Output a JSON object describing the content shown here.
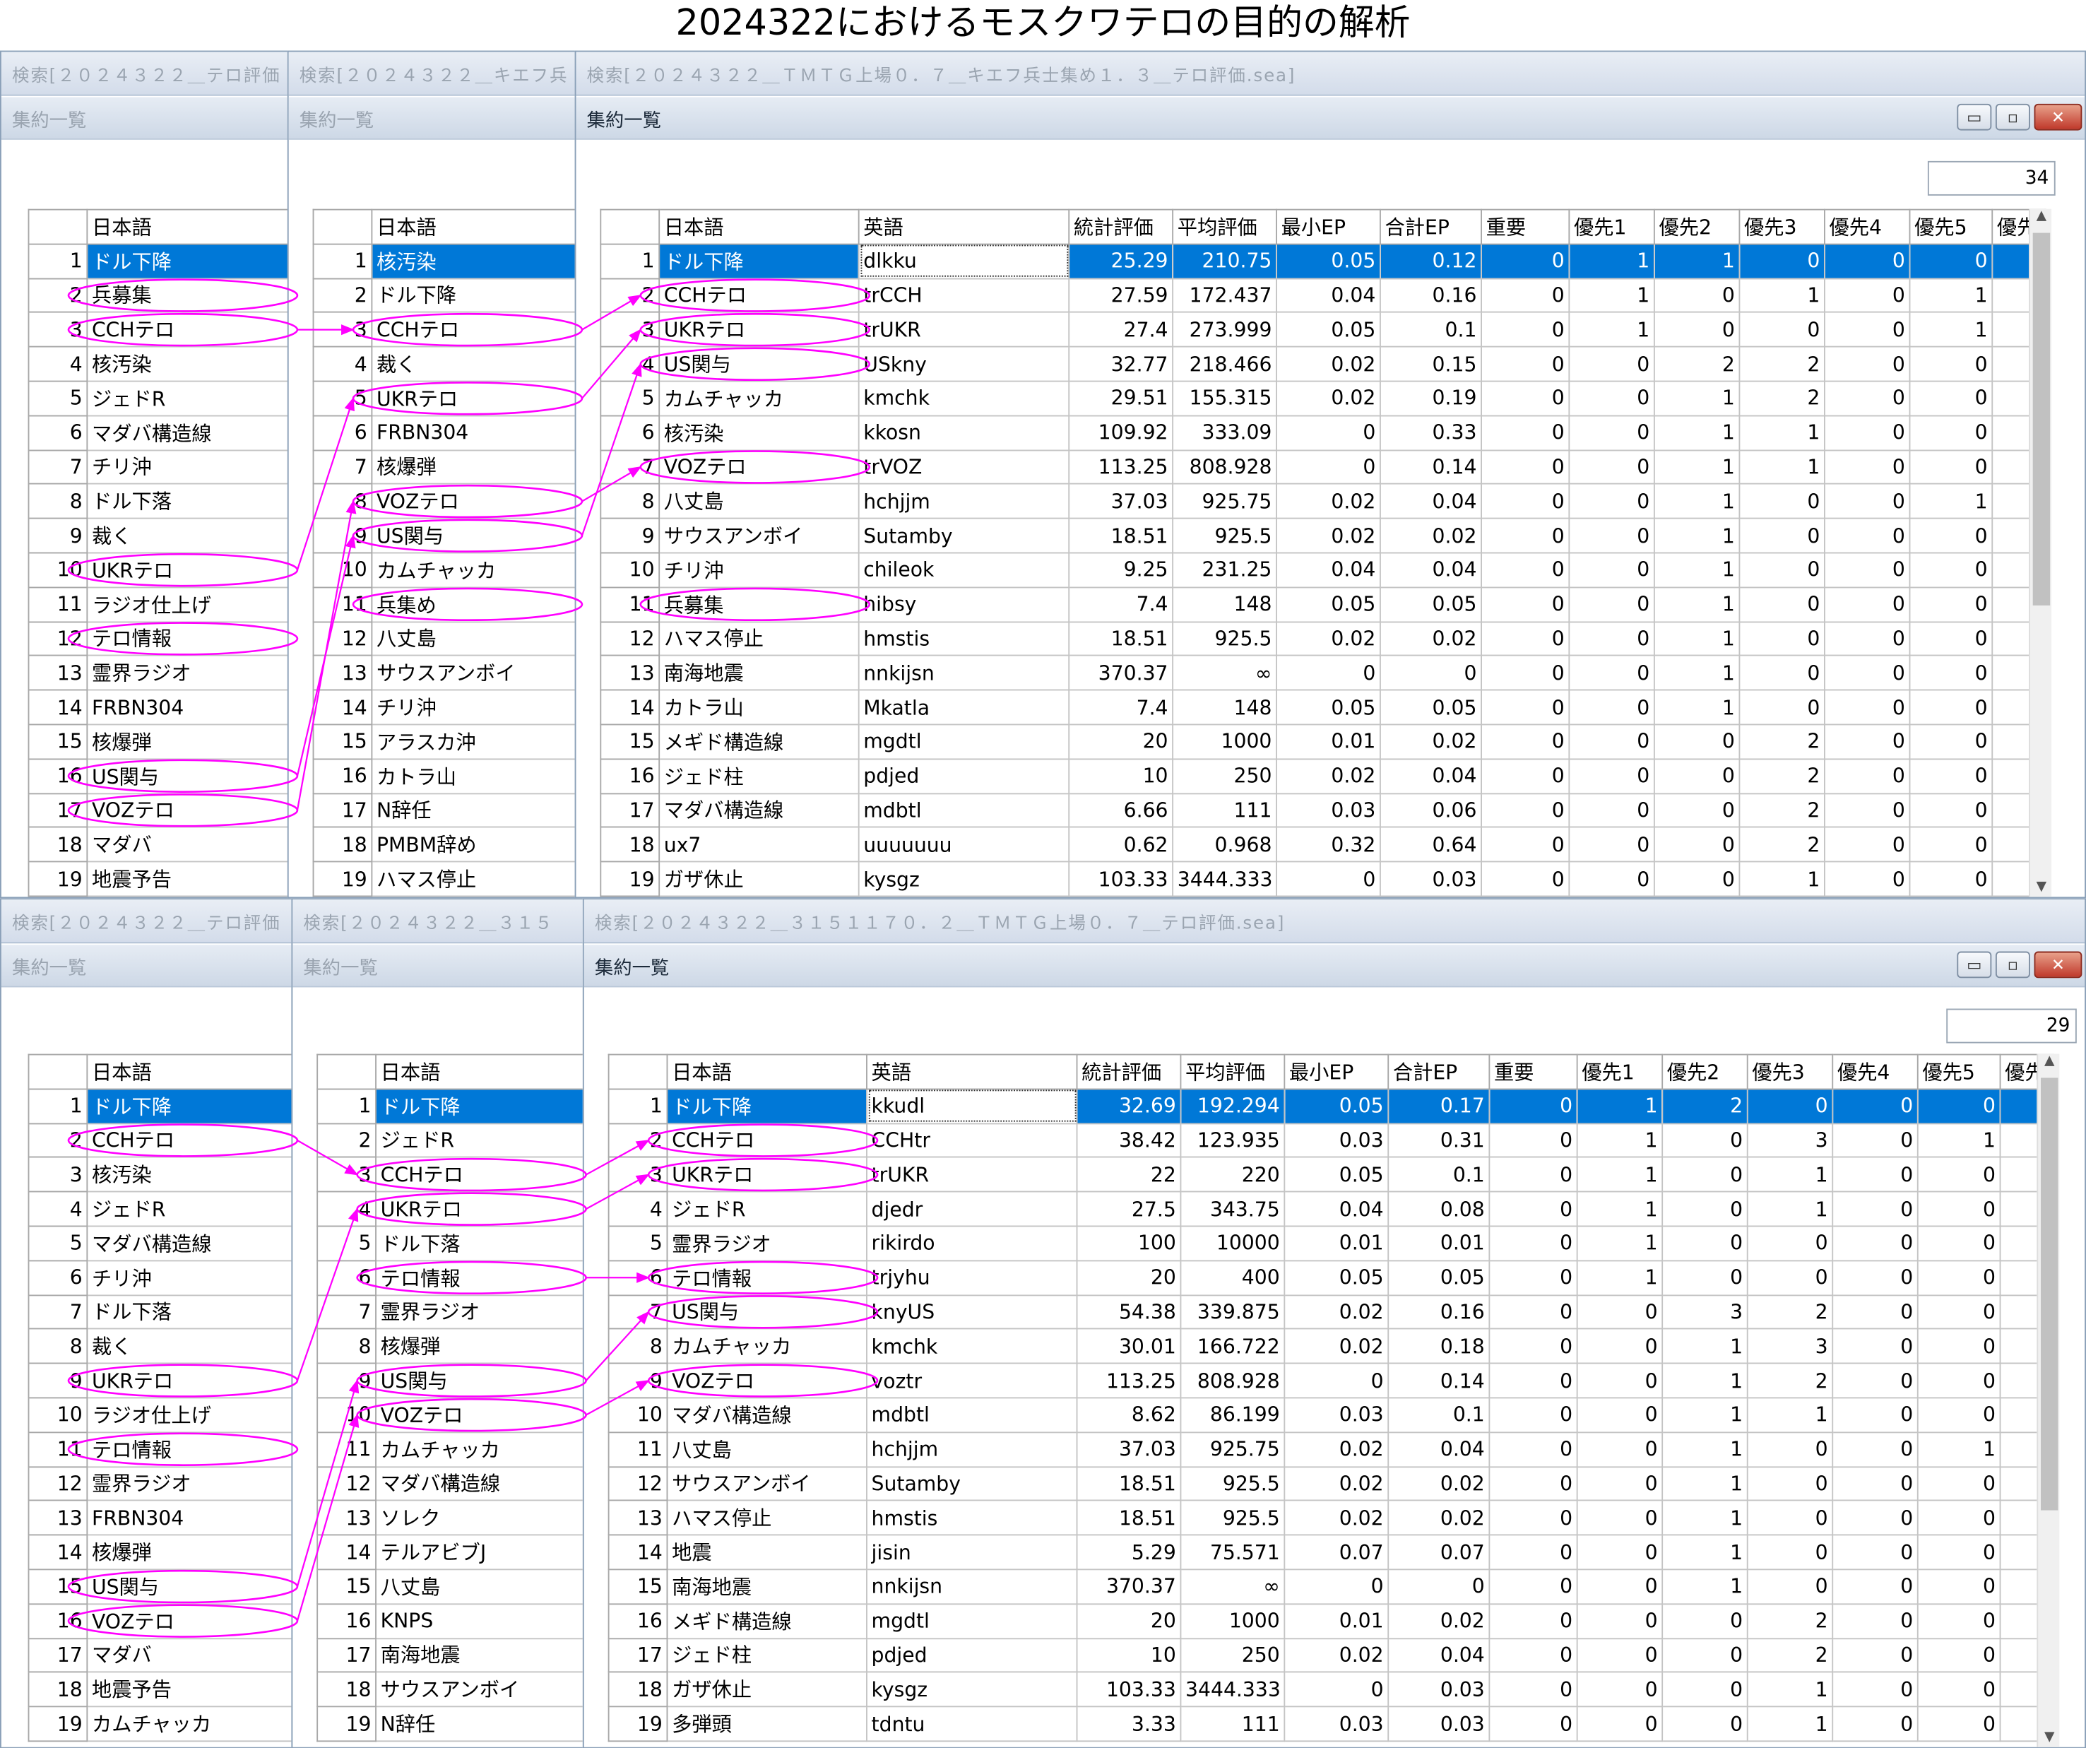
{
  "title": "2024322におけるモスクワテロの目的の解析",
  "colors": {
    "selection": "#0078d7",
    "annotation": "#ff00ff"
  },
  "panels": [
    {
      "windows": [
        {
          "search_title": "検索[２０２４３２２＿テロ評価",
          "subtitle": "集約一覧",
          "col_name": "日本語",
          "rows": [
            "ドル下降",
            "兵募集",
            "CCHテロ",
            "核汚染",
            "ジェドR",
            "マダバ構造線",
            "チリ沖",
            "ドル下落",
            "裁く",
            "UKRテロ",
            "ラジオ仕上げ",
            "テロ情報",
            "霊界ラジオ",
            "FRBN304",
            "核爆弾",
            "US関与",
            "VOZテロ",
            "マダバ",
            "地震予告"
          ]
        },
        {
          "search_title": "検索[２０２４３２２＿キエフ兵",
          "subtitle": "集約一覧",
          "col_name": "日本語",
          "rows": [
            "核汚染",
            "ドル下降",
            "CCHテロ",
            "裁く",
            "UKRテロ",
            "FRBN304",
            "核爆弾",
            "VOZテロ",
            "US関与",
            "カムチャッカ",
            "兵集め",
            "八丈島",
            "サウスアンボイ",
            "チリ沖",
            "アラスカ沖",
            "カトラ山",
            "N辞任",
            "PMBM辞め",
            "ハマス停止"
          ]
        }
      ],
      "main": {
        "search_title": "検索[２０２４３２２＿ＴＭＴＧ上場０．７＿キエフ兵士集め１．３＿テロ評価.sea]",
        "subtitle": "集約一覧",
        "count": "34",
        "columns": [
          "日本語",
          "英語",
          "統計評価",
          "平均評価",
          "最小EP",
          "合計EP",
          "重要",
          "優先1",
          "優先2",
          "優先3",
          "優先4",
          "優先5",
          "優先"
        ],
        "rows": [
          [
            "ドル下降",
            "dlkku",
            "25.29",
            "210.75",
            "0.05",
            "0.12",
            "0",
            "1",
            "1",
            "0",
            "0",
            "0"
          ],
          [
            "CCHテロ",
            "trCCH",
            "27.59",
            "172.437",
            "0.04",
            "0.16",
            "0",
            "1",
            "0",
            "1",
            "0",
            "1"
          ],
          [
            "UKRテロ",
            "trUKR",
            "27.4",
            "273.999",
            "0.05",
            "0.1",
            "0",
            "1",
            "0",
            "0",
            "0",
            "1"
          ],
          [
            "US関与",
            "USkny",
            "32.77",
            "218.466",
            "0.02",
            "0.15",
            "0",
            "0",
            "2",
            "2",
            "0",
            "0"
          ],
          [
            "カムチャッカ",
            "kmchk",
            "29.51",
            "155.315",
            "0.02",
            "0.19",
            "0",
            "0",
            "1",
            "2",
            "0",
            "0"
          ],
          [
            "核汚染",
            "kkosn",
            "109.92",
            "333.09",
            "0",
            "0.33",
            "0",
            "0",
            "1",
            "1",
            "0",
            "0"
          ],
          [
            "VOZテロ",
            "trVOZ",
            "113.25",
            "808.928",
            "0",
            "0.14",
            "0",
            "0",
            "1",
            "1",
            "0",
            "0"
          ],
          [
            "八丈島",
            "hchjjm",
            "37.03",
            "925.75",
            "0.02",
            "0.04",
            "0",
            "0",
            "1",
            "0",
            "0",
            "1"
          ],
          [
            "サウスアンボイ",
            "Sutamby",
            "18.51",
            "925.5",
            "0.02",
            "0.02",
            "0",
            "0",
            "1",
            "0",
            "0",
            "0"
          ],
          [
            "チリ沖",
            "chileok",
            "9.25",
            "231.25",
            "0.04",
            "0.04",
            "0",
            "0",
            "1",
            "0",
            "0",
            "0"
          ],
          [
            "兵募集",
            "hibsy",
            "7.4",
            "148",
            "0.05",
            "0.05",
            "0",
            "0",
            "1",
            "0",
            "0",
            "0"
          ],
          [
            "ハマス停止",
            "hmstis",
            "18.51",
            "925.5",
            "0.02",
            "0.02",
            "0",
            "0",
            "1",
            "0",
            "0",
            "0"
          ],
          [
            "南海地震",
            "nnkijsn",
            "370.37",
            "∞",
            "0",
            "0",
            "0",
            "0",
            "1",
            "0",
            "0",
            "0"
          ],
          [
            "カトラ山",
            "Mkatla",
            "7.4",
            "148",
            "0.05",
            "0.05",
            "0",
            "0",
            "1",
            "0",
            "0",
            "0"
          ],
          [
            "メギド構造線",
            "mgdtl",
            "20",
            "1000",
            "0.01",
            "0.02",
            "0",
            "0",
            "0",
            "2",
            "0",
            "0"
          ],
          [
            "ジェド柱",
            "pdjed",
            "10",
            "250",
            "0.02",
            "0.04",
            "0",
            "0",
            "0",
            "2",
            "0",
            "0"
          ],
          [
            "マダバ構造線",
            "mdbtl",
            "6.66",
            "111",
            "0.03",
            "0.06",
            "0",
            "0",
            "0",
            "2",
            "0",
            "0"
          ],
          [
            "ux7",
            "uuuuuuu",
            "0.62",
            "0.968",
            "0.32",
            "0.64",
            "0",
            "0",
            "0",
            "2",
            "0",
            "0"
          ],
          [
            "ガザ休止",
            "kysgz",
            "103.33",
            "3444.333",
            "0",
            "0.03",
            "0",
            "0",
            "0",
            "1",
            "0",
            "0"
          ]
        ]
      }
    },
    {
      "windows": [
        {
          "search_title": "検索[２０２４３２２＿テロ評価",
          "subtitle": "集約一覧",
          "col_name": "日本語",
          "rows": [
            "ドル下降",
            "CCHテロ",
            "核汚染",
            "ジェドR",
            "マダバ構造線",
            "チリ沖",
            "ドル下落",
            "裁く",
            "UKRテロ",
            "ラジオ仕上げ",
            "テロ情報",
            "霊界ラジオ",
            "FRBN304",
            "核爆弾",
            "US関与",
            "VOZテロ",
            "マダバ",
            "地震予告",
            "カムチャッカ"
          ]
        },
        {
          "search_title": "検索[２０２４３２２＿３１５",
          "subtitle": "集約一覧",
          "col_name": "日本語",
          "rows": [
            "ドル下降",
            "ジェドR",
            "CCHテロ",
            "UKRテロ",
            "ドル下落",
            "テロ情報",
            "霊界ラジオ",
            "核爆弾",
            "US関与",
            "VOZテロ",
            "カムチャッカ",
            "マダバ構造線",
            "ソレク",
            "テルアビブJ",
            "八丈島",
            "KNPS",
            "南海地震",
            "サウスアンボイ",
            "N辞任"
          ]
        }
      ],
      "main": {
        "search_title": "検索[２０２４３２２＿３１５１１７０．２＿ＴＭＴＧ上場０．７＿テロ評価.sea]",
        "subtitle": "集約一覧",
        "count": "29",
        "columns": [
          "日本語",
          "英語",
          "統計評価",
          "平均評価",
          "最小EP",
          "合計EP",
          "重要",
          "優先1",
          "優先2",
          "優先3",
          "優先4",
          "優先5",
          "優先"
        ],
        "rows": [
          [
            "ドル下降",
            "kkudl",
            "32.69",
            "192.294",
            "0.05",
            "0.17",
            "0",
            "1",
            "2",
            "0",
            "0",
            "0"
          ],
          [
            "CCHテロ",
            "CCHtr",
            "38.42",
            "123.935",
            "0.03",
            "0.31",
            "0",
            "1",
            "0",
            "3",
            "0",
            "1"
          ],
          [
            "UKRテロ",
            "trUKR",
            "22",
            "220",
            "0.05",
            "0.1",
            "0",
            "1",
            "0",
            "1",
            "0",
            "0"
          ],
          [
            "ジェドR",
            "djedr",
            "27.5",
            "343.75",
            "0.04",
            "0.08",
            "0",
            "1",
            "0",
            "1",
            "0",
            "0"
          ],
          [
            "霊界ラジオ",
            "rikirdo",
            "100",
            "10000",
            "0.01",
            "0.01",
            "0",
            "1",
            "0",
            "0",
            "0",
            "0"
          ],
          [
            "テロ情報",
            "trjyhu",
            "20",
            "400",
            "0.05",
            "0.05",
            "0",
            "1",
            "0",
            "0",
            "0",
            "0"
          ],
          [
            "US関与",
            "knyUS",
            "54.38",
            "339.875",
            "0.02",
            "0.16",
            "0",
            "0",
            "3",
            "2",
            "0",
            "0"
          ],
          [
            "カムチャッカ",
            "kmchk",
            "30.01",
            "166.722",
            "0.02",
            "0.18",
            "0",
            "0",
            "1",
            "3",
            "0",
            "0"
          ],
          [
            "VOZテロ",
            "voztr",
            "113.25",
            "808.928",
            "0",
            "0.14",
            "0",
            "0",
            "1",
            "2",
            "0",
            "0"
          ],
          [
            "マダバ構造線",
            "mdbtl",
            "8.62",
            "86.199",
            "0.03",
            "0.1",
            "0",
            "0",
            "1",
            "1",
            "0",
            "0"
          ],
          [
            "八丈島",
            "hchjjm",
            "37.03",
            "925.75",
            "0.02",
            "0.04",
            "0",
            "0",
            "1",
            "0",
            "0",
            "1"
          ],
          [
            "サウスアンボイ",
            "Sutamby",
            "18.51",
            "925.5",
            "0.02",
            "0.02",
            "0",
            "0",
            "1",
            "0",
            "0",
            "0"
          ],
          [
            "ハマス停止",
            "hmstis",
            "18.51",
            "925.5",
            "0.02",
            "0.02",
            "0",
            "0",
            "1",
            "0",
            "0",
            "0"
          ],
          [
            "地震",
            "jisin",
            "5.29",
            "75.571",
            "0.07",
            "0.07",
            "0",
            "0",
            "1",
            "0",
            "0",
            "0"
          ],
          [
            "南海地震",
            "nnkijsn",
            "370.37",
            "∞",
            "0",
            "0",
            "0",
            "0",
            "1",
            "0",
            "0",
            "0"
          ],
          [
            "メギド構造線",
            "mgdtl",
            "20",
            "1000",
            "0.01",
            "0.02",
            "0",
            "0",
            "0",
            "2",
            "0",
            "0"
          ],
          [
            "ジェド柱",
            "pdjed",
            "10",
            "250",
            "0.02",
            "0.04",
            "0",
            "0",
            "0",
            "2",
            "0",
            "0"
          ],
          [
            "ガザ休止",
            "kysgz",
            "103.33",
            "3444.333",
            "0",
            "0.03",
            "0",
            "0",
            "0",
            "1",
            "0",
            "0"
          ],
          [
            "多弾頭",
            "tdntu",
            "3.33",
            "111",
            "0.03",
            "0.03",
            "0",
            "0",
            "0",
            "1",
            "0",
            "0"
          ]
        ]
      }
    }
  ],
  "window_controls": {
    "minimize": "▭",
    "maximize": "▫",
    "close": "✕"
  },
  "scroll_arrows": {
    "up": "▲",
    "down": "▼"
  }
}
